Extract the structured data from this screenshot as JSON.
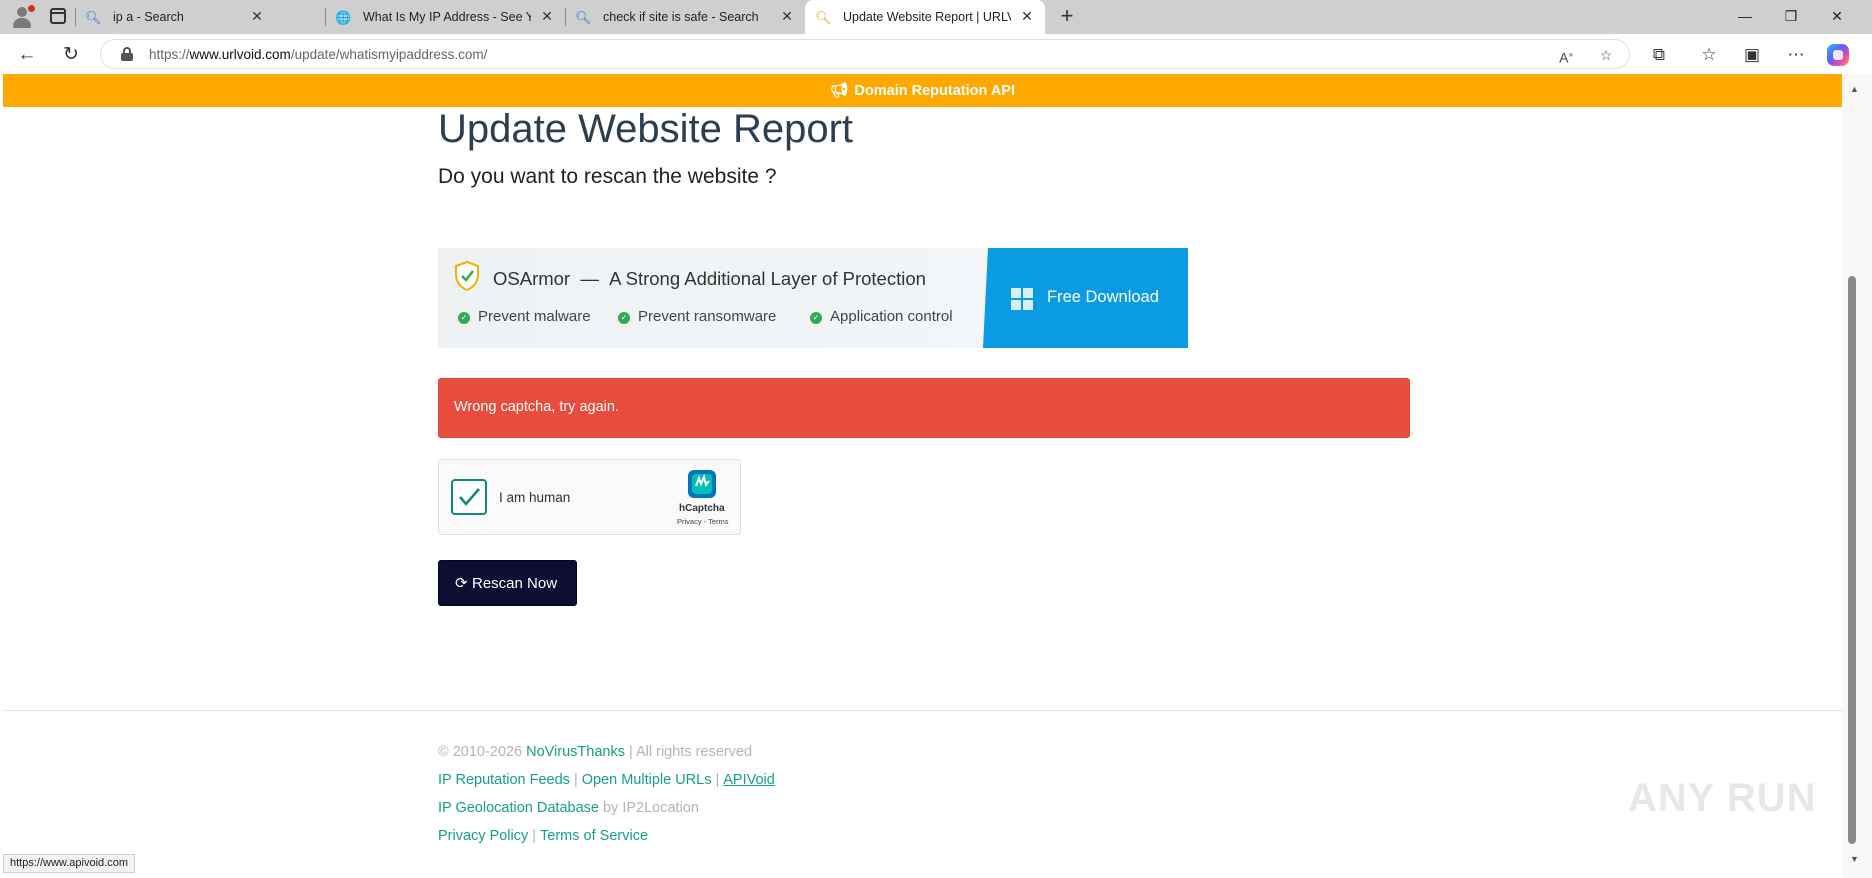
{
  "browser": {
    "tabs": [
      {
        "title": "ip a - Search",
        "icon": "search-icon"
      },
      {
        "title": "What Is My IP Address - See Your",
        "icon": "globe-icon"
      },
      {
        "title": "check if site is safe - Search",
        "icon": "search-icon"
      },
      {
        "title": "Update Website Report | URLVoid",
        "icon": "search-icon",
        "active": true
      }
    ],
    "url_scheme": "https://",
    "url_domain": "www.urlvoid.com",
    "url_path": "/update/whatismyipaddress.com/"
  },
  "promo": {
    "label": "Domain Reputation API",
    "icon": "megaphone-icon",
    "background": "#ffa900"
  },
  "page": {
    "title": "Update Website Report",
    "subtitle": "Do you want to rescan the website ?"
  },
  "ad": {
    "brand": "OSArmor",
    "dash": "—",
    "tagline": "A Strong Additional Layer of Protection",
    "features": [
      "Prevent malware",
      "Prevent ransomware",
      "Application control"
    ],
    "cta": "Free Download",
    "cta_color": "#0a9be3"
  },
  "alert": {
    "message": "Wrong captcha, try again.",
    "color": "#e74c3c"
  },
  "captcha": {
    "label": "I am human",
    "brand": "hCaptcha",
    "privacy": "Privacy",
    "terms": "Terms",
    "checked": true
  },
  "rescan": {
    "label": "Rescan Now",
    "icon": "refresh-icon",
    "color": "#0e0d33"
  },
  "footer": {
    "copyright": "© 2010-2026",
    "company": "NoVirusThanks",
    "rights": "| All rights reserved",
    "links_row1": [
      "IP Reputation Feeds",
      "Open Multiple URLs",
      "APIVoid"
    ],
    "geo_link": "IP Geolocation Database",
    "geo_by": "by IP2Location",
    "links_row3": [
      "Privacy Policy",
      "Terms of Service"
    ],
    "link_color": "#16a085"
  },
  "watermark": "ANY RUN",
  "status_url": "https://www.apivoid.com"
}
